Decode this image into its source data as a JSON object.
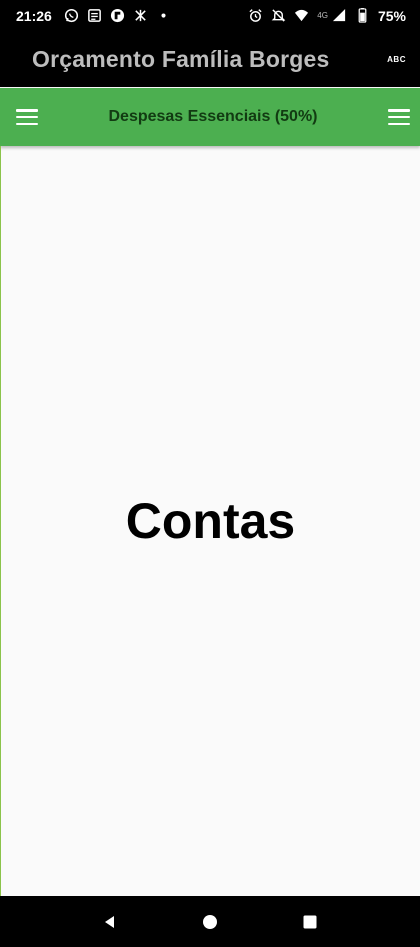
{
  "status_bar": {
    "time": "21:26",
    "network_type": "4G",
    "battery": "75%",
    "left_icons": [
      "whatsapp-icon",
      "news-icon",
      "flipboard-icon",
      "dnd-icon",
      "dot-icon"
    ],
    "right_icons": [
      "alarm-icon",
      "notifications-off-icon",
      "wifi-icon",
      "signal-icon",
      "battery-icon"
    ]
  },
  "app_bar": {
    "title": "Orçamento Família Borges",
    "action_label": "ABC"
  },
  "sub_bar": {
    "title": "Despesas Essenciais (50%)",
    "left_icon": "menu-icon",
    "right_icon": "menu-icon"
  },
  "main": {
    "heading": "Contas"
  },
  "nav_bar": {
    "buttons": [
      "back-icon",
      "home-icon",
      "recents-icon"
    ]
  },
  "colors": {
    "accent": "#4caf50",
    "title_text": "#bdbdbd",
    "background": "#fafafa"
  }
}
